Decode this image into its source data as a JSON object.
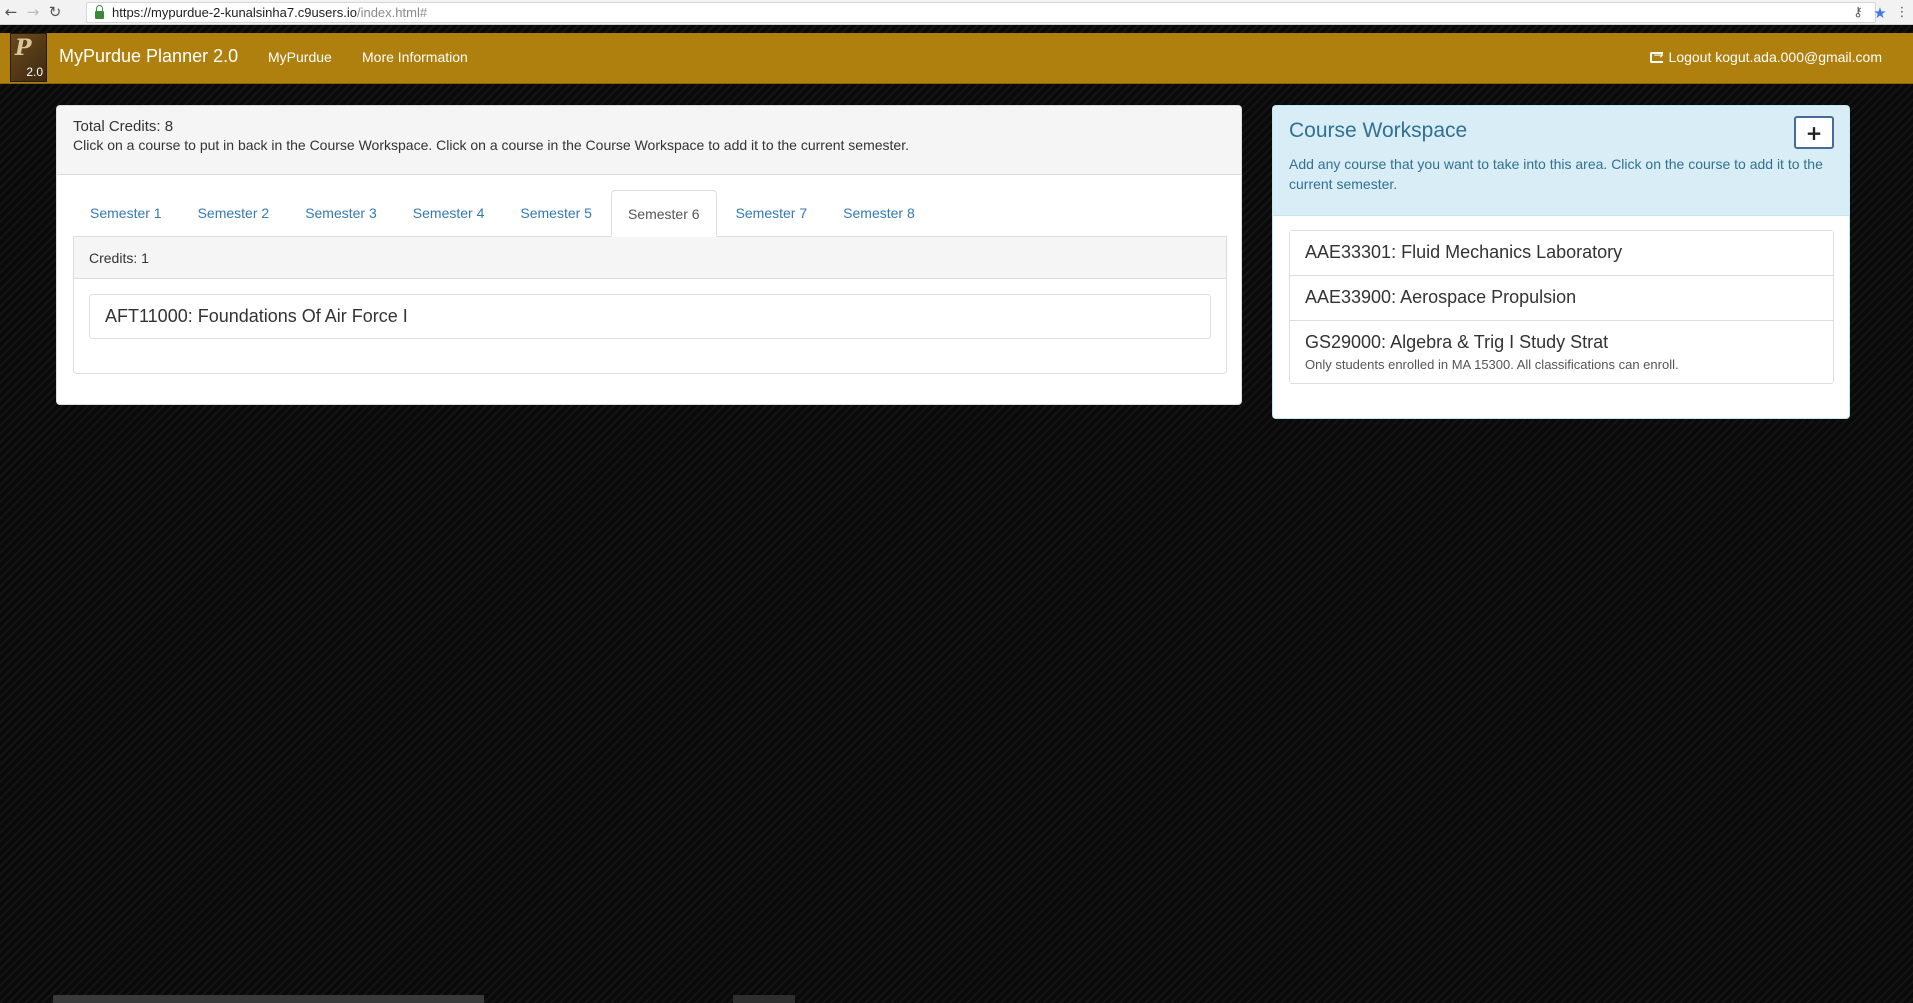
{
  "browser": {
    "url_main": "https://mypurdue-2-kunalsinha7.c9users.io",
    "url_path": "/index.html#",
    "back_glyph": "←",
    "forward_glyph": "→",
    "reload_glyph": "↻",
    "key_glyph": "⚷",
    "star_glyph": "★",
    "menu_glyph": "⋮"
  },
  "navbar": {
    "logo_letter": "P",
    "logo_version": "2.0",
    "brand": "MyPurdue Planner 2.0",
    "links": [
      "MyPurdue",
      "More Information"
    ],
    "logout_label": "Logout kogut.ada.000@gmail.com",
    "color": "#b0800e"
  },
  "planner": {
    "total_credits": "Total Credits: 8",
    "instructions": "Click on a course to put in back in the Course Workspace. Click on a course in the Course Workspace to add it to the current semester.",
    "tabs": [
      "Semester 1",
      "Semester 2",
      "Semester 3",
      "Semester 4",
      "Semester 5",
      "Semester 6",
      "Semester 7",
      "Semester 8"
    ],
    "active_tab": "Semester 6",
    "semester_credits": "Credits: 1",
    "semester_courses": [
      "AFT11000: Foundations Of Air Force I"
    ]
  },
  "workspace": {
    "title": "Course Workspace",
    "add_label": "+",
    "description": "Add any course that you want to take into this area. Click on the course to add it to the current semester.",
    "courses": [
      {
        "title": "AAE33301: Fluid Mechanics Laboratory",
        "note": ""
      },
      {
        "title": "AAE33900: Aerospace Propulsion",
        "note": ""
      },
      {
        "title": "GS29000: Algebra & Trig I Study Strat",
        "note": "Only students enrolled in MA 15300. All classifications can enroll."
      }
    ]
  }
}
